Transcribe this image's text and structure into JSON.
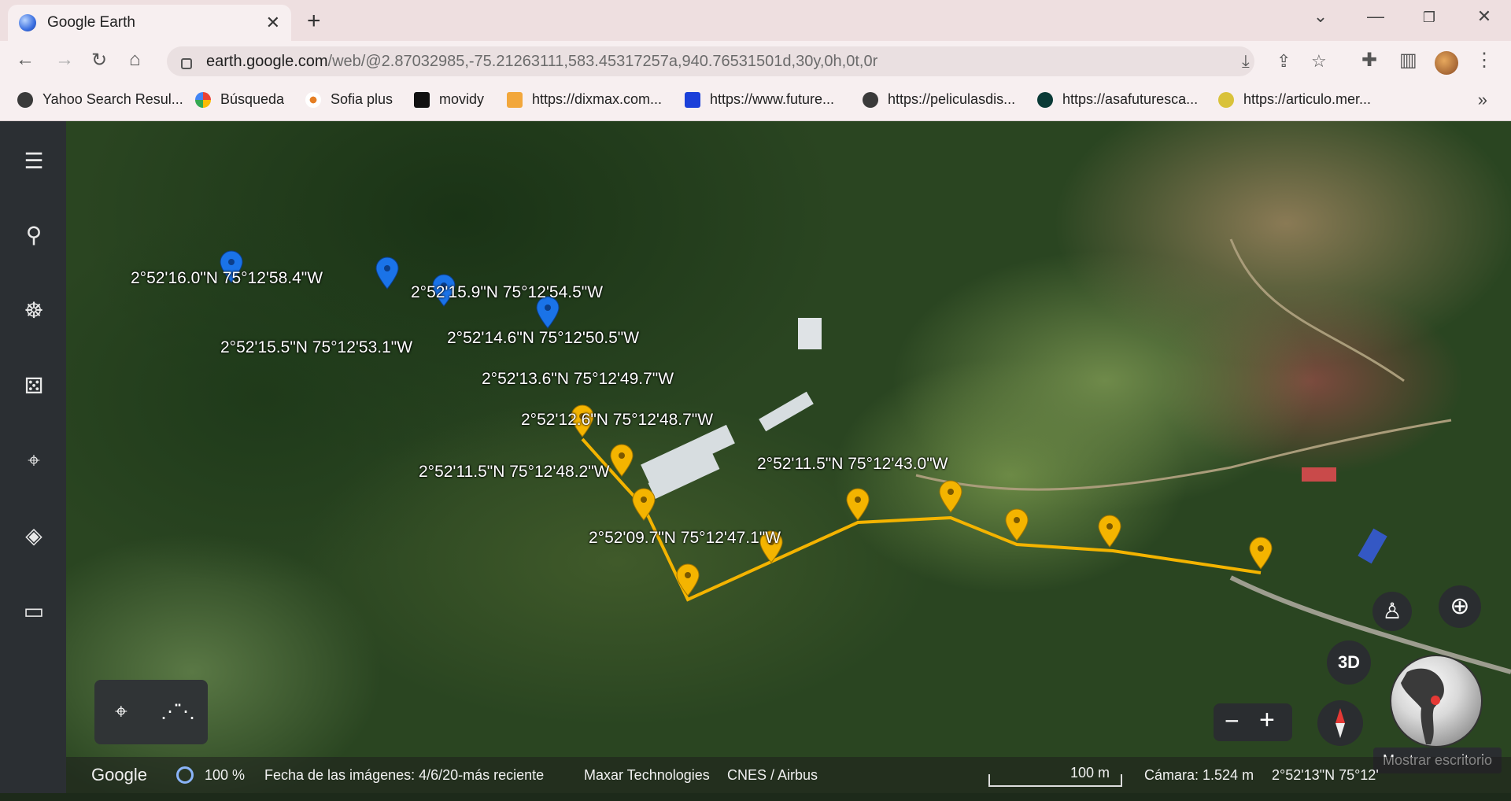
{
  "browser": {
    "tab_title": "Google Earth",
    "new_tab": "+",
    "url_host": "earth.google.com",
    "url_path": "/web/@2.87032985,-75.21263111,583.45317257a,940.76531501d,30y,0h,0t,0r",
    "bookmarks": [
      {
        "label": "Yahoo Search Resul...",
        "icon": "globe-icon",
        "color": "#3a3a3a"
      },
      {
        "label": "Búsqueda",
        "icon": "google-g-icon",
        "color": "#4285f4"
      },
      {
        "label": "Sofia plus",
        "icon": "sofia-dots-icon",
        "color": "#e57e24"
      },
      {
        "label": "movidy",
        "icon": "movidy-icon",
        "color": "#111111"
      },
      {
        "label": "https://dixmax.com...",
        "icon": "play-icon",
        "color": "#f2a73b"
      },
      {
        "label": "https://www.future...",
        "icon": "fm-icon",
        "color": "#1a40d9"
      },
      {
        "label": "https://peliculasdis...",
        "icon": "globe-icon",
        "color": "#3a3a3a"
      },
      {
        "label": "https://asafuturesca...",
        "icon": "triangle-icon",
        "color": "#0a3a36"
      },
      {
        "label": "https://articulo.mer...",
        "icon": "mercado-icon",
        "color": "#d9c23a"
      }
    ],
    "bookmarks_more": "»"
  },
  "sidebar": {
    "items": [
      "menu-icon",
      "search-icon",
      "voyager-icon",
      "random-dice-icon",
      "projects-pin-icon",
      "layers-icon",
      "ruler-icon"
    ]
  },
  "map": {
    "labels": [
      "2°52'16.0\"N 75°12'58.4\"W",
      "2°52'15.9\"N 75°12'54.5\"W",
      "2°52'15.5\"N 75°12'53.1\"W",
      "2°52'14.6\"N 75°12'50.5\"W",
      "2°52'13.6\"N 75°12'49.7\"W",
      "2°52'12.6\"N 75°12'48.7\"W",
      "2°52'11.5\"N 75°12'48.2\"W",
      "2°52'11.5\"N 75°12'43.0\"W",
      "2°52'09.7\"N 75°12'47.1\"W"
    ],
    "pin_colors": {
      "blue": "#1a73e8",
      "yellow": "#f4b400"
    },
    "path_color": "#f4b400"
  },
  "controls": {
    "view_3d": "3D",
    "zoom_out": "−",
    "zoom_in": "+",
    "tooltip": "Mostrar escritorio"
  },
  "status": {
    "logo": "Google",
    "loading": "100 %",
    "imagery_date": "Fecha de las imágenes: 4/6/20-más reciente",
    "provider1": "Maxar Technologies",
    "provider2": "CNES / Airbus",
    "scale": "100 m",
    "camera": "Cámara: 1.524 m",
    "cursor_coords": "2°52'13\"N 75°12'"
  }
}
